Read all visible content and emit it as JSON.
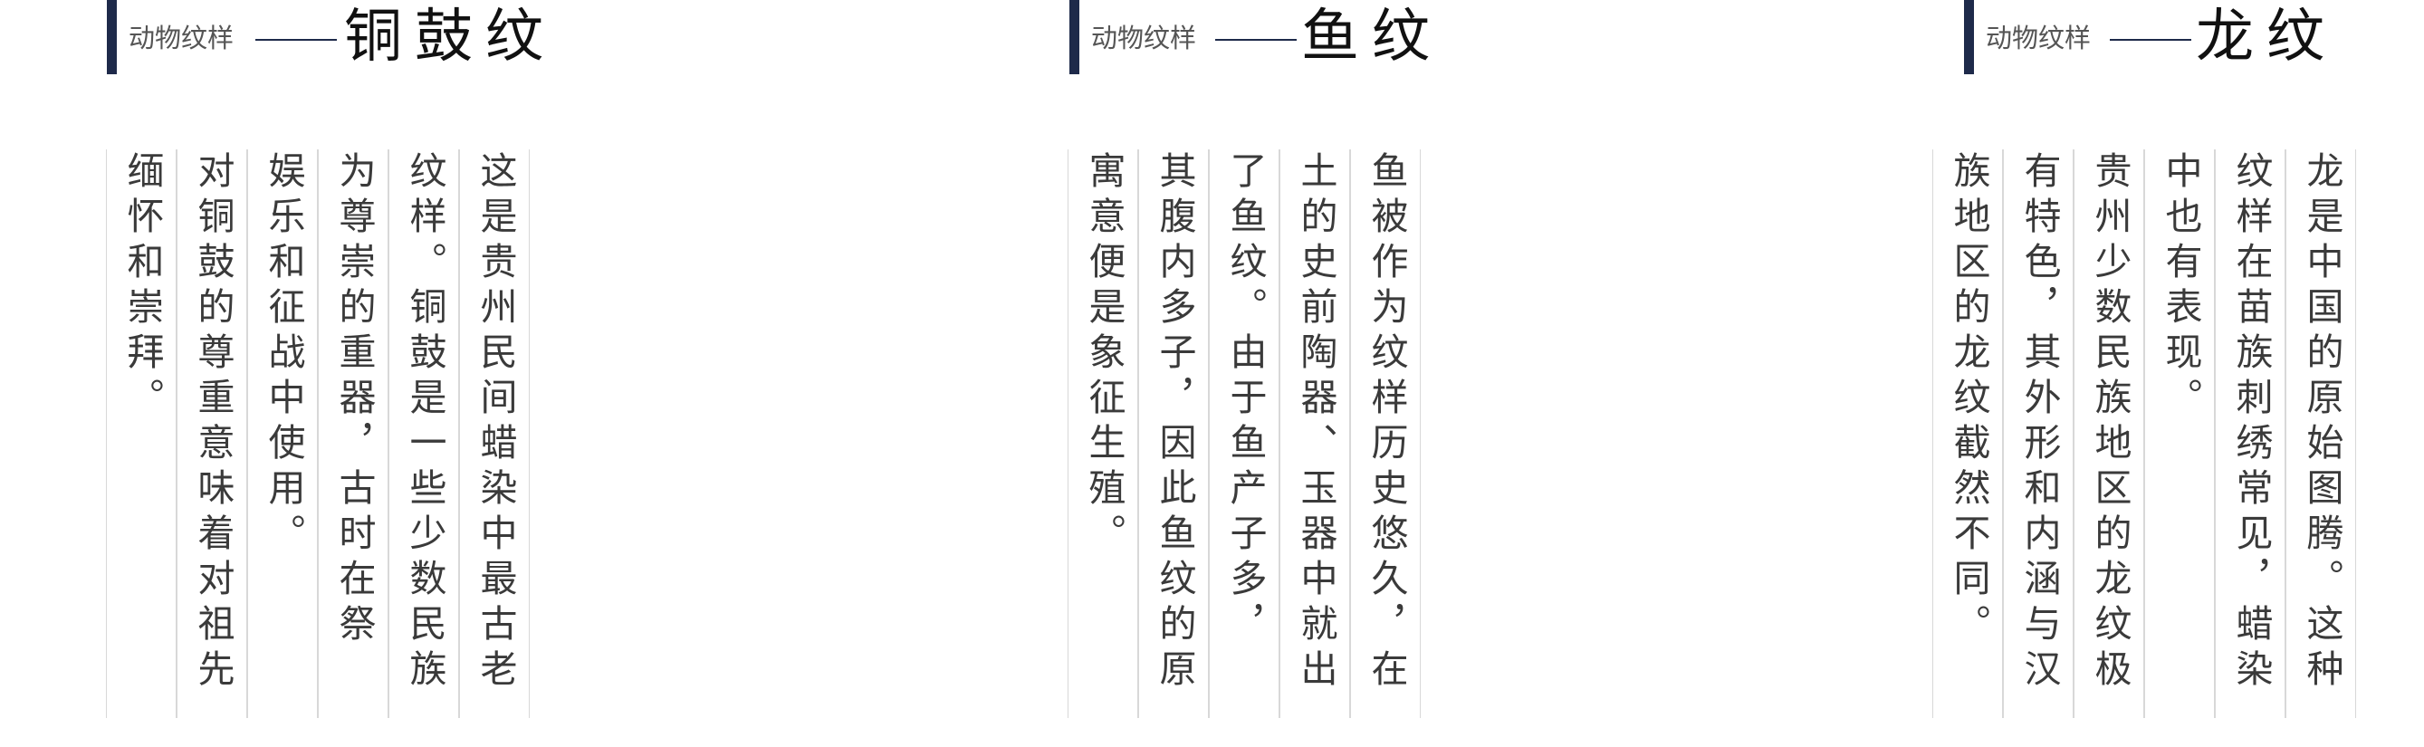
{
  "sections": [
    {
      "subtitle": "动物纹样",
      "title": "铜鼓纹",
      "columns": [
        "这是贵州民间蜡染中最古老的",
        "纹样。铜鼓是一些少数民族极",
        "为尊崇的重器，古时在祭祀、",
        "娱乐和征战中使用。",
        "对铜鼓的尊重意味着对祖先的",
        "缅怀和崇拜。"
      ]
    },
    {
      "subtitle": "动物纹样",
      "title": "鱼纹",
      "columns": [
        "鱼被作为纹样历史悠久，在出",
        "土的史前陶器、玉器中就出现",
        "了鱼纹。由于鱼产子多，",
        "其腹内多子，因此鱼纹的原始",
        "寓意便是象征生殖。"
      ]
    },
    {
      "subtitle": "动物纹样",
      "title": "龙纹",
      "columns": [
        "龙是中国的原始图腾。这种",
        "纹样在苗族刺绣常见，蜡染",
        "中也有表现。",
        "贵州少数民族地区的龙纹极",
        "有特色，其外形和内涵与汉",
        "族地区的龙纹截然不同。"
      ]
    }
  ]
}
